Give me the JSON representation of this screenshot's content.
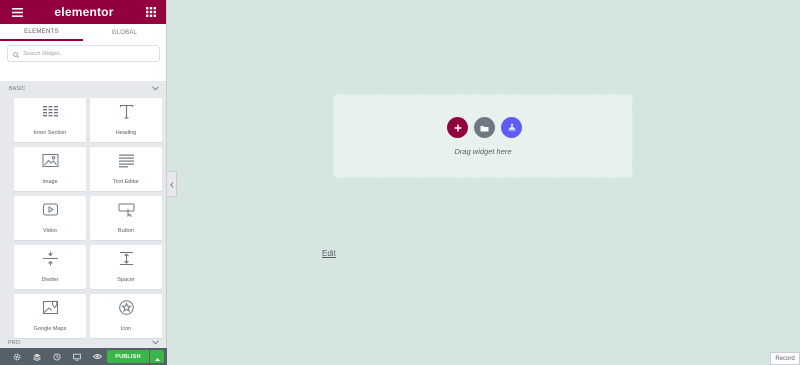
{
  "app": {
    "logo_text": "elementor"
  },
  "tabs": [
    {
      "label": "ELEMENTS"
    },
    {
      "label": "GLOBAL"
    }
  ],
  "search": {
    "placeholder": "Search Widget..."
  },
  "sections": {
    "basic_label": "BASIC",
    "pro_label": "PRO"
  },
  "widgets": [
    {
      "label": "Inner Section",
      "icon": "inner-section-icon"
    },
    {
      "label": "Heading",
      "icon": "heading-icon"
    },
    {
      "label": "Image",
      "icon": "image-icon"
    },
    {
      "label": "Text Editor",
      "icon": "text-editor-icon"
    },
    {
      "label": "Video",
      "icon": "video-icon"
    },
    {
      "label": "Button",
      "icon": "button-icon"
    },
    {
      "label": "Divider",
      "icon": "divider-icon"
    },
    {
      "label": "Spacer",
      "icon": "spacer-icon"
    },
    {
      "label": "Google Maps",
      "icon": "google-maps-icon"
    },
    {
      "label": "Icon",
      "icon": "star-icon"
    }
  ],
  "footer": {
    "publish_label": "PUBLISH"
  },
  "canvas": {
    "drop_text": "Drag widget here",
    "edit_link": "Edit"
  },
  "record_label": "Record",
  "colors": {
    "brand": "#93003f",
    "publish": "#39b54a",
    "canvas_bg": "#d5e5df",
    "template_btn": "#6d7882",
    "kit_btn": "#5d5df5"
  }
}
